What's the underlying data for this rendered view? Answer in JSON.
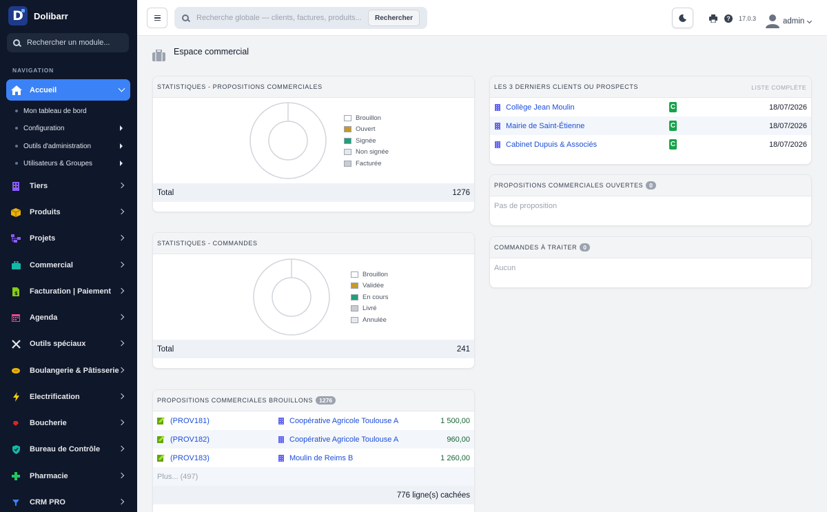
{
  "app": {
    "name": "Dolibarr",
    "logo_letter": "D",
    "version": "17.0.3"
  },
  "sidebar": {
    "search_placeholder": "Rechercher un module...",
    "section_label": "NAVIGATION",
    "active_item": "Accueil",
    "sub_items": [
      "Mon tableau de bord",
      "Configuration",
      "Outils d'administration",
      "Utilisateurs & Groupes"
    ],
    "items": [
      {
        "label": "Tiers",
        "icon": "building-icon",
        "color": "#8b5cf6"
      },
      {
        "label": "Produits",
        "icon": "box-icon",
        "color": "#eab308"
      },
      {
        "label": "Projets",
        "icon": "sitemap-icon",
        "color": "#8b5cf6"
      },
      {
        "label": "Commercial",
        "icon": "briefcase-icon",
        "color": "#14b8a6"
      },
      {
        "label": "Facturation | Paiement",
        "icon": "invoice-icon",
        "color": "#84cc16"
      },
      {
        "label": "Agenda",
        "icon": "calendar-icon",
        "color": "#ec4899"
      },
      {
        "label": "Outils spéciaux",
        "icon": "tools-icon",
        "color": "#e5e7eb"
      },
      {
        "label": "Boulangerie & Pâtisserie",
        "icon": "bread-icon",
        "color": "#eab308"
      },
      {
        "label": "Electrification",
        "icon": "bolt-icon",
        "color": "#facc15"
      },
      {
        "label": "Boucherie",
        "icon": "meat-icon",
        "color": "#dc2626"
      },
      {
        "label": "Bureau de Contrôle",
        "icon": "shield-icon",
        "color": "#14b8a6"
      },
      {
        "label": "Pharmacie",
        "icon": "plus-icon",
        "color": "#22c55e"
      },
      {
        "label": "CRM PRO",
        "icon": "funnel-icon",
        "color": "#3b82f6"
      }
    ]
  },
  "topbar": {
    "search_placeholder": "Recherche globale — clients, factures, produits...",
    "search_button": "Rechercher",
    "user": "admin"
  },
  "page": {
    "title": "Espace commercial"
  },
  "stats_proposals": {
    "title": "STATISTIQUES - PROPOSITIONS COMMERCIALES",
    "legend": [
      {
        "label": "Brouillon",
        "color": "#ffffff"
      },
      {
        "label": "Ouvert",
        "color": "#c8982a"
      },
      {
        "label": "Signée",
        "color": "#1f9f7a"
      },
      {
        "label": "Non signée",
        "color": "#e5e9ec"
      },
      {
        "label": "Facturée",
        "color": "#c9cdd2"
      }
    ],
    "total_label": "Total",
    "total_value": "1276"
  },
  "stats_orders": {
    "title": "STATISTIQUES - COMMANDES",
    "legend": [
      {
        "label": "Brouillon",
        "color": "#ffffff"
      },
      {
        "label": "Validée",
        "color": "#c8982a"
      },
      {
        "label": "En cours",
        "color": "#1f9f7a"
      },
      {
        "label": "Livré",
        "color": "#c9cdd2"
      },
      {
        "label": "Annulée",
        "color": "#e5e9ec"
      }
    ],
    "total_label": "Total",
    "total_value": "241"
  },
  "draft_proposals": {
    "title": "PROPOSITIONS COMMERCIALES BROUILLONS",
    "count": "1276",
    "rows": [
      {
        "ref": "(PROV181)",
        "client": "Coopérative Agricole Toulouse A",
        "amount": "1 500,00"
      },
      {
        "ref": "(PROV182)",
        "client": "Coopérative Agricole Toulouse A",
        "amount": "960,00"
      },
      {
        "ref": "(PROV183)",
        "client": "Moulin de Reims B",
        "amount": "1 260,00"
      }
    ],
    "more": "Plus... (497)",
    "hidden": "776 ligne(s) cachées"
  },
  "last_clients": {
    "title": "LES 3 DERNIERS CLIENTS OU PROSPECTS",
    "link": "LISTE COMPLÈTE",
    "rows": [
      {
        "name": "Collège Jean Moulin",
        "type": "C",
        "date": "18/07/2026"
      },
      {
        "name": "Mairie de Saint-Étienne",
        "type": "C",
        "date": "18/07/2026"
      },
      {
        "name": "Cabinet Dupuis & Associés",
        "type": "C",
        "date": "18/07/2026"
      }
    ]
  },
  "open_proposals": {
    "title": "PROPOSITIONS COMMERCIALES OUVERTES",
    "count": "0",
    "empty": "Pas de proposition"
  },
  "orders_todo": {
    "title": "COMMANDES À TRAITER",
    "count": "0",
    "empty": "Aucun"
  }
}
